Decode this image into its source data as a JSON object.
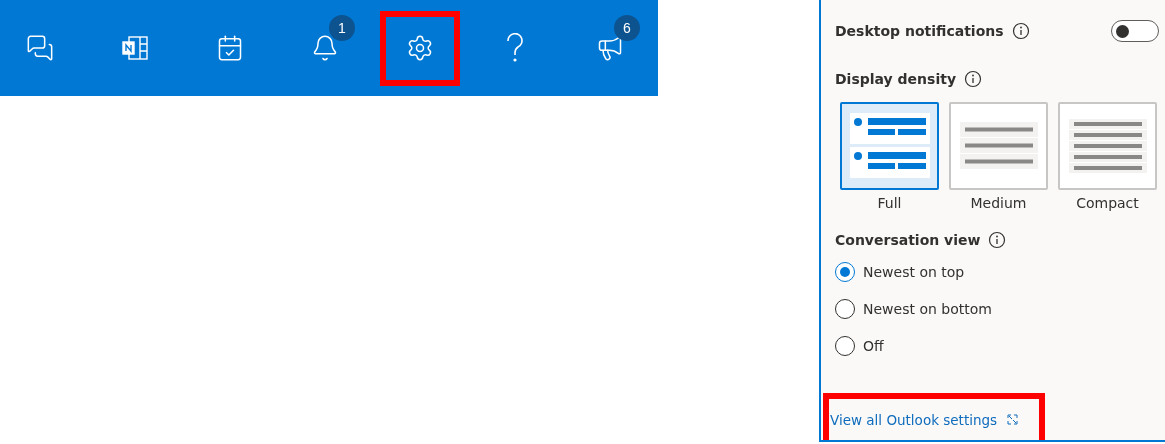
{
  "toolbar": {
    "buttons": [
      {
        "kind": "chat",
        "highlighted": false
      },
      {
        "kind": "notebook",
        "highlighted": false
      },
      {
        "kind": "calendar",
        "highlighted": false
      },
      {
        "kind": "bell",
        "highlighted": false,
        "badge": "1"
      },
      {
        "kind": "settings",
        "highlighted": true
      },
      {
        "kind": "help",
        "highlighted": false
      },
      {
        "kind": "megaphone",
        "highlighted": false,
        "badge": "6"
      }
    ]
  },
  "settings_panel": {
    "desktop_notifications": {
      "label": "Desktop notifications",
      "on": false
    },
    "display_density": {
      "label": "Display density",
      "options": [
        {
          "kind": "full",
          "label": "Full",
          "selected": true
        },
        {
          "kind": "medium",
          "label": "Medium",
          "selected": false
        },
        {
          "kind": "compact",
          "label": "Compact",
          "selected": false
        }
      ]
    },
    "conversation_view": {
      "label": "Conversation view",
      "options": [
        {
          "label": "Newest on top",
          "selected": true
        },
        {
          "label": "Newest on bottom",
          "selected": false
        },
        {
          "label": "Off",
          "selected": false
        }
      ]
    },
    "link": {
      "label": "View all Outlook settings",
      "highlighted": true
    }
  }
}
